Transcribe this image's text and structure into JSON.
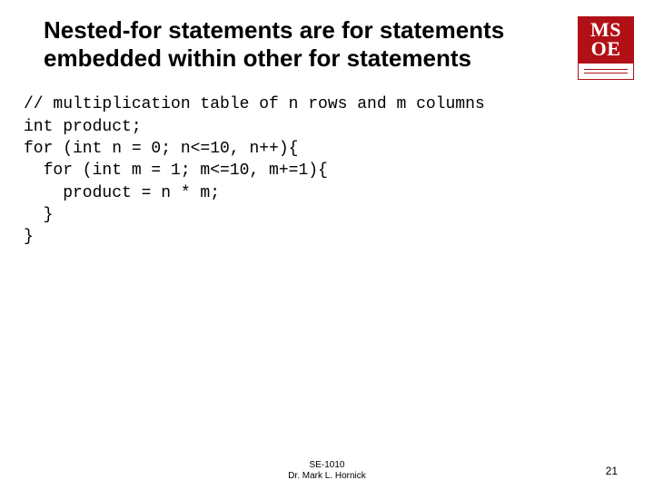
{
  "title": "Nested-for statements are for statements embedded within other for statements",
  "code": {
    "l1": "// multiplication table of n rows and m columns",
    "l2": "int product;",
    "l3": "for (int n = 0; n<=10, n++){",
    "l4": "  for (int m = 1; m<=10, m+=1){",
    "l5": "    product = n * m;",
    "l6": "  }",
    "l7": "}"
  },
  "logo": {
    "line1": "MS",
    "line2": "OE"
  },
  "footer": {
    "course": "SE-1010",
    "author": "Dr. Mark L. Hornick"
  },
  "page_number": "21"
}
